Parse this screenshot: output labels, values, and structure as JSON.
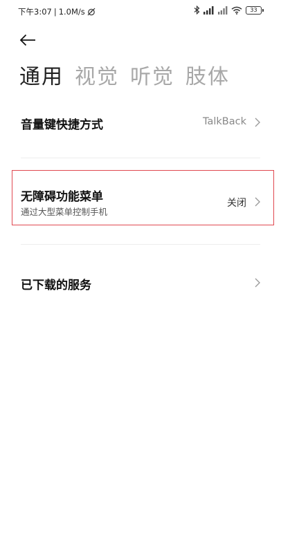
{
  "status_bar": {
    "time": "下午3:07",
    "separator": "|",
    "speed": "1.0M/s",
    "battery": "33"
  },
  "header": {
    "tabs": [
      {
        "label": "通用",
        "active": true
      },
      {
        "label": "视觉",
        "active": false
      },
      {
        "label": "听觉",
        "active": false
      },
      {
        "label": "肢体",
        "active": false
      }
    ]
  },
  "items": {
    "volume_shortcut": {
      "title": "音量键快捷方式",
      "value": "TalkBack"
    },
    "accessibility_menu": {
      "title": "无障碍功能菜单",
      "subtitle": "通过大型菜单控制手机",
      "value": "关闭"
    },
    "downloaded_services": {
      "title": "已下载的服务"
    }
  },
  "colors": {
    "active_tab": "#222222",
    "inactive_tab": "#a8a8a8",
    "highlight_border": "#e0474f"
  }
}
